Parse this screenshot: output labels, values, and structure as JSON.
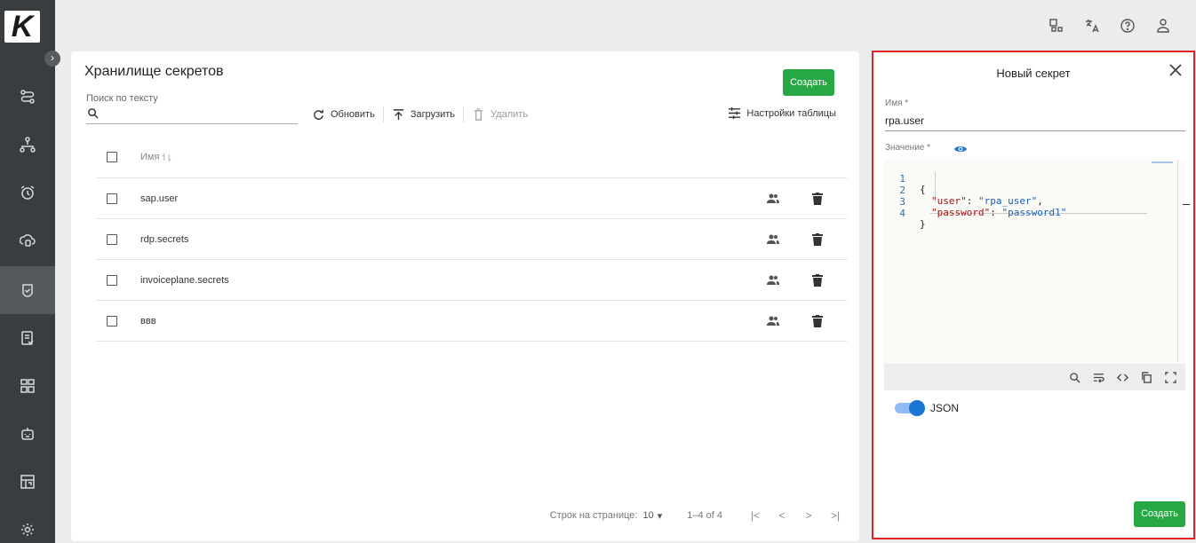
{
  "brand": {
    "logo_letter": "K",
    "accent": "#28a745",
    "highlight_border": "#e32222"
  },
  "sidebar": {
    "expand_icon": "chevron-right-icon",
    "items": [
      {
        "icon": "routes-icon",
        "active": false
      },
      {
        "icon": "hierarchy-icon",
        "active": false
      },
      {
        "icon": "alarm-clock-icon",
        "active": false
      },
      {
        "icon": "cloud-database-icon",
        "active": false
      },
      {
        "icon": "shield-check-icon",
        "active": true
      },
      {
        "icon": "list-check-icon",
        "active": false
      },
      {
        "icon": "widgets-icon",
        "active": false
      },
      {
        "icon": "robot-icon",
        "active": false
      },
      {
        "icon": "calendar-table-icon",
        "active": false
      },
      {
        "icon": "gear-icon",
        "active": false
      }
    ]
  },
  "topbar": {
    "icons": [
      "apps-icon",
      "translate-icon",
      "help-icon",
      "user-icon"
    ]
  },
  "main": {
    "title": "Хранилище секретов",
    "create_label": "Создать",
    "search": {
      "label": "Поиск по тексту",
      "value": ""
    },
    "toolbar": {
      "refresh": "Обновить",
      "upload": "Загрузить",
      "delete": "Удалить",
      "table_settings": "Настройки таблицы"
    },
    "table": {
      "columns": [
        "Имя"
      ],
      "rows": [
        {
          "name": "sap.user"
        },
        {
          "name": "rdp.secrets"
        },
        {
          "name": "invoiceplane.secrets"
        },
        {
          "name": "ввв"
        }
      ]
    },
    "pagination": {
      "rows_per_page_label": "Строк на странице:",
      "rows_per_page": "10",
      "range": "1–4 of 4"
    }
  },
  "panel": {
    "title": "Новый секрет",
    "name_label": "Имя *",
    "name_value": "rpa.user",
    "value_label": "Значение *",
    "code_lines": [
      {
        "n": "1",
        "text": "{"
      },
      {
        "n": "2",
        "key": "\"user\"",
        "sep": ": ",
        "val": "\"rpa_user\"",
        "end": ","
      },
      {
        "n": "3",
        "key": "\"password\"",
        "sep": ": ",
        "val": "\"password1\"",
        "end": ""
      },
      {
        "n": "4",
        "text": "}"
      }
    ],
    "editor_tools": [
      "search-icon",
      "wrap-icon",
      "code-icon",
      "copy-icon",
      "fullscreen-icon"
    ],
    "json_toggle_label": "JSON",
    "json_toggle_on": true,
    "create_label": "Создать"
  }
}
